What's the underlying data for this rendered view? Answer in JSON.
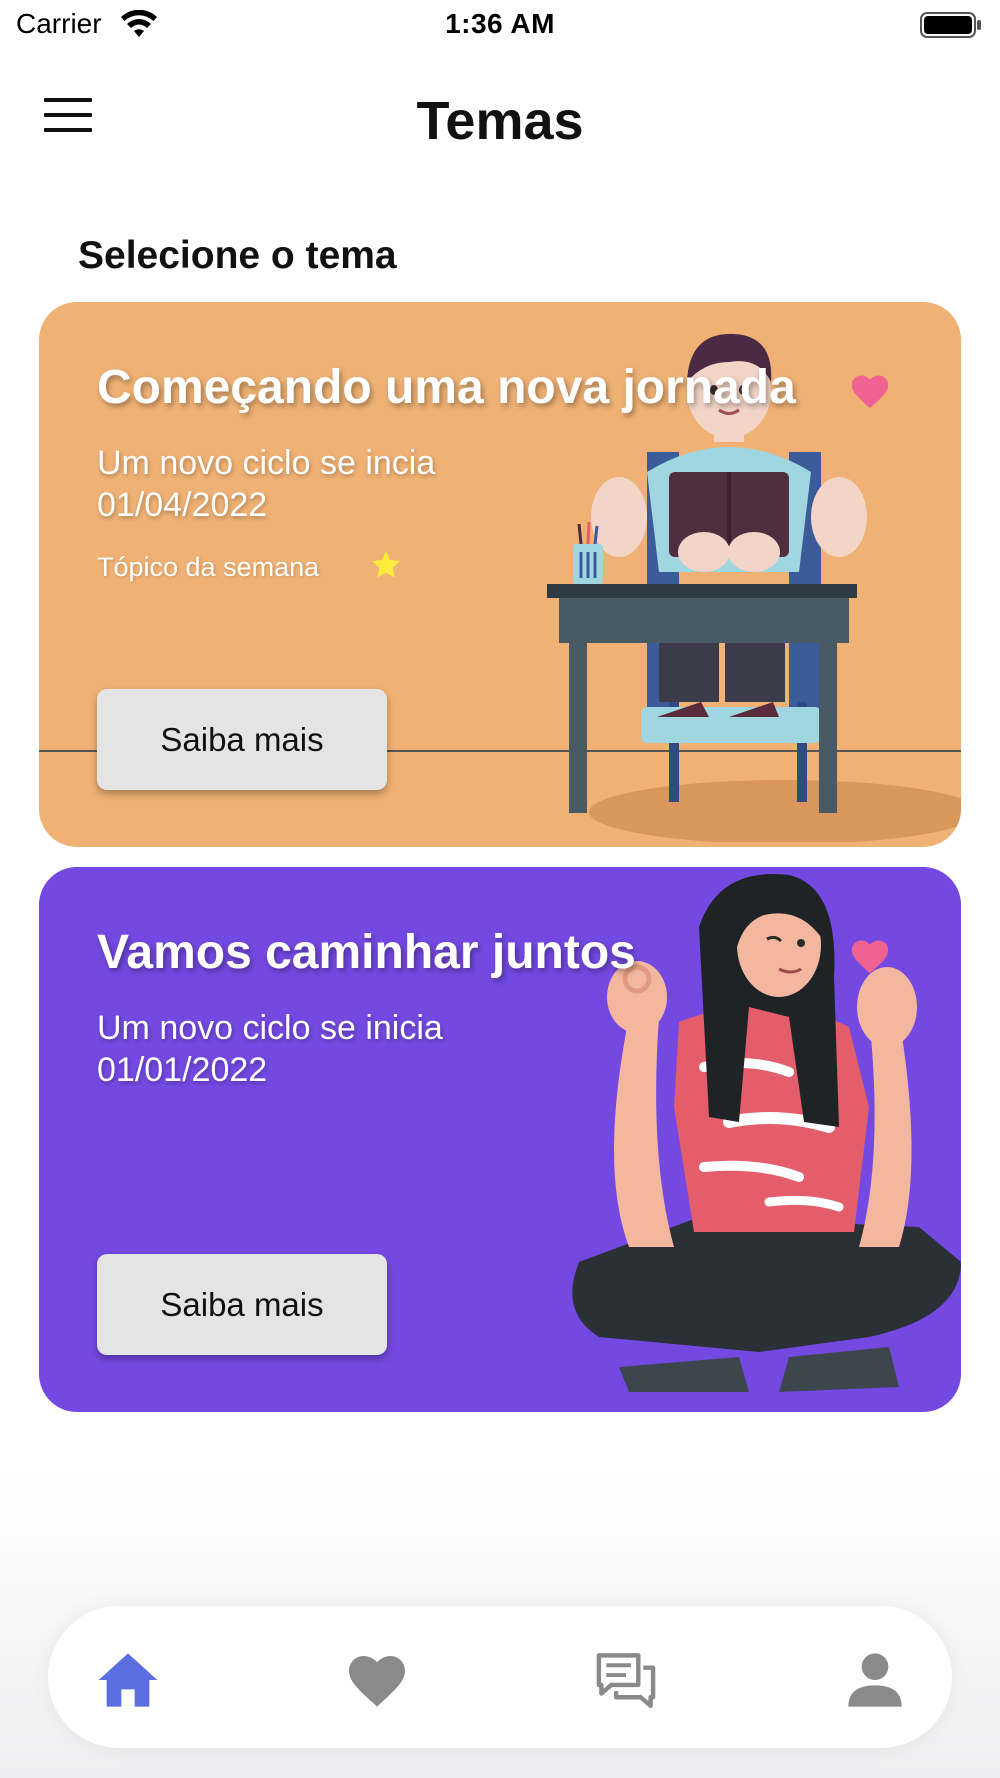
{
  "status_bar": {
    "carrier": "Carrier",
    "time": "1:36 AM",
    "icons": [
      "wifi-icon",
      "battery-icon"
    ]
  },
  "header": {
    "title": "Temas",
    "menu_icon": "hamburger-menu-icon"
  },
  "section_title": "Selecione o tema",
  "cards": [
    {
      "title": "Começando uma nova jornada",
      "subtitle": "Um novo ciclo se incia",
      "date": "01/04/2022",
      "topic_label": "Tópico da semana",
      "topic_icon": "star-icon",
      "favorite_icon": "heart-icon",
      "button_label": "Saiba mais",
      "background": "#f0b274",
      "illustration": "boy-reading-at-desk"
    },
    {
      "title": "Vamos caminhar juntos",
      "subtitle": "Um novo ciclo se inicia",
      "date": "01/01/2022",
      "favorite_icon": "heart-icon",
      "button_label": "Saiba mais",
      "background": "#7449e2",
      "illustration": "woman-ok-gesture-sitting"
    }
  ],
  "tab_bar": {
    "items": [
      {
        "icon": "home-icon",
        "active": true
      },
      {
        "icon": "heart-icon",
        "active": false
      },
      {
        "icon": "chat-icon",
        "active": false
      },
      {
        "icon": "person-icon",
        "active": false
      }
    ],
    "active_color": "#5a6ee0",
    "inactive_color": "#8a8a8a"
  },
  "colors": {
    "favorite_heart": "#f06292",
    "star": "#ffeb3b"
  }
}
